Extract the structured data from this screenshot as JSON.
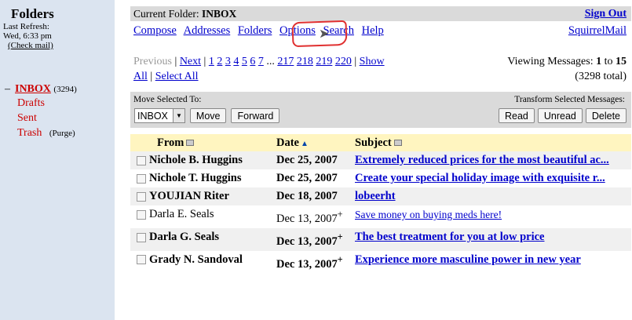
{
  "sidebar": {
    "title": "Folders",
    "last_refresh_label": "Last Refresh:",
    "last_refresh_time": "Wed, 6:33 pm",
    "check_mail": "(Check mail)",
    "folders": [
      {
        "name": "INBOX",
        "count": "(3294)",
        "active": true
      },
      {
        "name": "Drafts"
      },
      {
        "name": "Sent"
      },
      {
        "name": "Trash",
        "extra": "(Purge)"
      }
    ]
  },
  "topbar": {
    "current_folder_label": "Current Folder:",
    "current_folder": "INBOX",
    "sign_out": "Sign Out"
  },
  "nav": {
    "compose": "Compose",
    "addresses": "Addresses",
    "folders": "Folders",
    "options": "Options",
    "search": "Search",
    "help": "Help",
    "squirrelmail": "SquirrelMail"
  },
  "pager": {
    "previous": "Previous",
    "next": "Next",
    "pages": [
      "1",
      "2",
      "3",
      "4",
      "5",
      "6",
      "7"
    ],
    "ellipsis": "...",
    "pages_end": [
      "217",
      "218",
      "219",
      "220"
    ],
    "show": "Show",
    "all": "All",
    "select_all": "Select All",
    "viewing_label": "Viewing Messages:",
    "from_num": "1",
    "to_label": "to",
    "to_num": "15",
    "total": "(3298 total)"
  },
  "movebar": {
    "move_label": "Move Selected To:",
    "transform_label": "Transform Selected Messages:",
    "folder_select": "INBOX",
    "move_btn": "Move",
    "forward_btn": "Forward",
    "read_btn": "Read",
    "unread_btn": "Unread",
    "delete_btn": "Delete"
  },
  "table": {
    "headers": {
      "from": "From",
      "date": "Date",
      "subject": "Subject"
    },
    "rows": [
      {
        "from": "Nichole B. Huggins",
        "date": "Dec 25, 2007",
        "subject": "Extremely reduced prices for the most beautiful ac...",
        "unread": true,
        "plus": ""
      },
      {
        "from": "Nichole T. Huggins",
        "date": "Dec 25, 2007",
        "subject": "Create your special holiday image with exquisite r...",
        "unread": true,
        "plus": ""
      },
      {
        "from": "YOUJIAN Riter",
        "date": "Dec 18, 2007",
        "subject": "lobeerht",
        "unread": true,
        "plus": ""
      },
      {
        "from": "Darla E. Seals",
        "date": "Dec 13, 2007",
        "subject": "Save money on buying meds here!",
        "unread": false,
        "plus": "+"
      },
      {
        "from": "Darla G. Seals",
        "date": "Dec 13, 2007",
        "subject": "The best treatment for you at low price",
        "unread": true,
        "plus": "+"
      },
      {
        "from": "Grady N. Sandoval",
        "date": "Dec 13, 2007",
        "subject": "Experience more masculine power in new year",
        "unread": true,
        "plus": "+"
      }
    ]
  },
  "colors": {
    "sidebar_bg": "#dbe4f0",
    "bar_bg": "#dadada",
    "header_bg": "#fff5c0",
    "link": "#0000cc",
    "folder": "#cc0000"
  }
}
